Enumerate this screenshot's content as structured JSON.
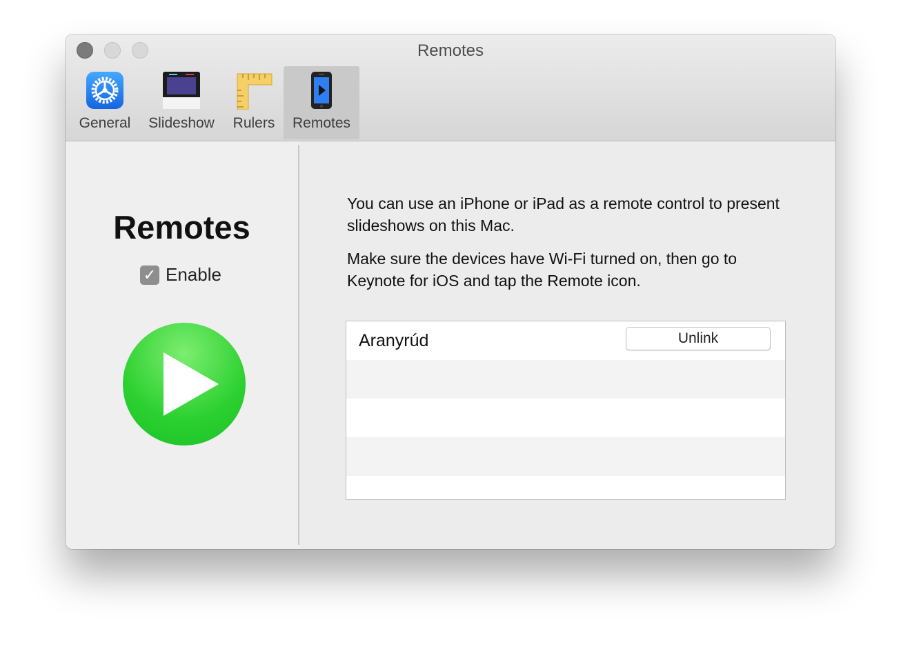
{
  "window": {
    "title": "Remotes"
  },
  "toolbar": {
    "tabs": [
      {
        "label": "General",
        "icon": "gear-icon"
      },
      {
        "label": "Slideshow",
        "icon": "slideshow-icon"
      },
      {
        "label": "Rulers",
        "icon": "ruler-icon"
      },
      {
        "label": "Remotes",
        "icon": "iphone-remote-icon"
      }
    ],
    "selected": "Remotes"
  },
  "left_panel": {
    "title": "Remotes",
    "enable_label": "Enable",
    "enable_checked": true
  },
  "right_panel": {
    "description_1": "You can use an iPhone or iPad as a remote control to present slideshows on this Mac.",
    "description_2": "Make sure the devices have Wi-Fi turned on, then go to Keynote for iOS and tap the Remote icon.",
    "devices": [
      {
        "name": "Aranyrúd",
        "action_label": "Unlink"
      }
    ]
  },
  "colors": {
    "play_green": "#2bd030",
    "selected_tab": "#c9c9c9",
    "general_icon_blue": "#2a7ff0"
  }
}
